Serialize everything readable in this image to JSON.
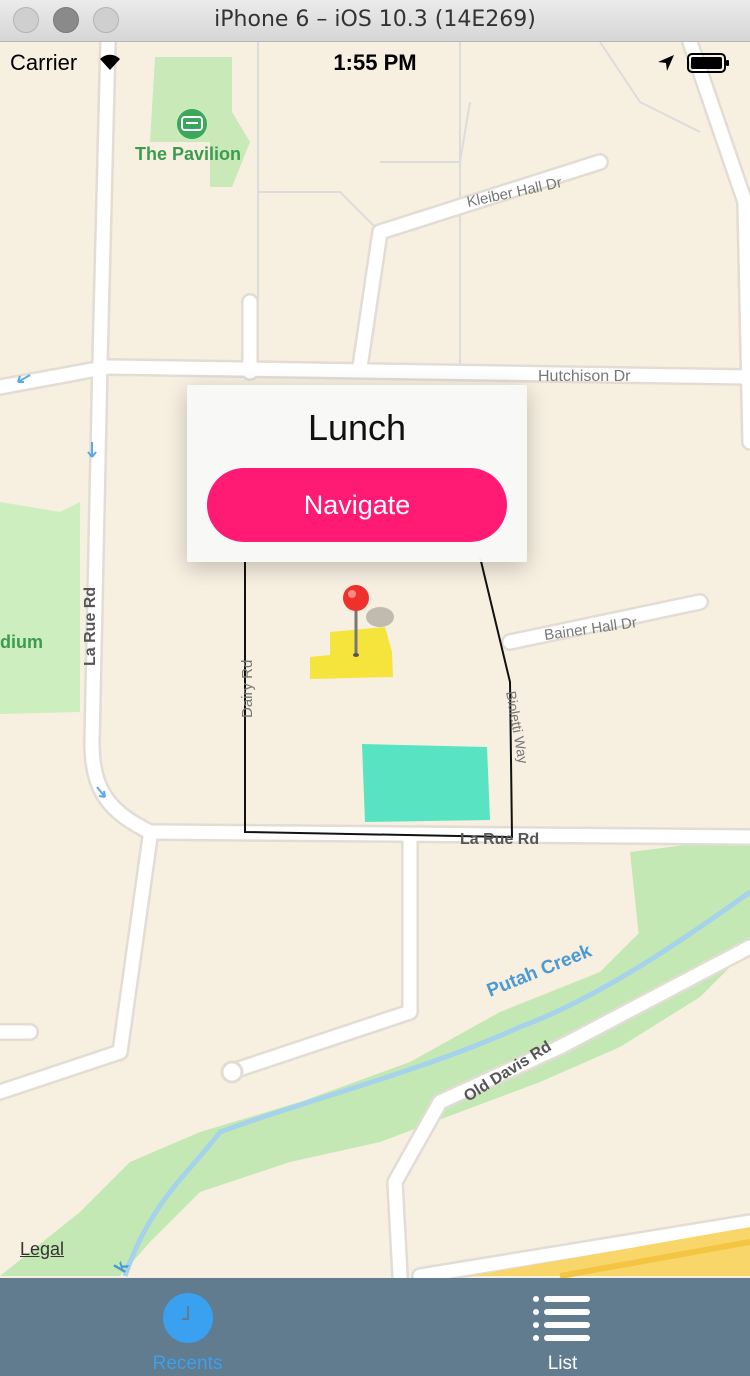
{
  "window": {
    "title": "iPhone 6 – iOS 10.3 (14E269)"
  },
  "status_bar": {
    "carrier": "Carrier",
    "time": "1:55 PM"
  },
  "map": {
    "labels": {
      "pavilion": "The Pavilion",
      "kleiber": "Kleiber Hall Dr",
      "hutchison": "Hutchison Dr",
      "la_rue_vertical": "La Rue Rd",
      "stadium": "dium",
      "dairy": "Dairy Rd",
      "bainer": "Bainer Hall Dr",
      "bioletti": "Bioletti Way",
      "la_rue_horizontal": "La Rue Rd",
      "putah": "Putah Creek",
      "old_davis": "Old Davis Rd",
      "creek_tail": "k"
    },
    "legal": "Legal"
  },
  "callout": {
    "title": "Lunch",
    "button_label": "Navigate"
  },
  "tab_bar": {
    "tabs": [
      {
        "label": "Recents",
        "icon": "clock-icon",
        "selected": true
      },
      {
        "label": "List",
        "icon": "list-icon",
        "selected": false
      }
    ]
  },
  "colors": {
    "accent": "#ff1a74",
    "tab_bar": "#617b8f",
    "tab_selected": "#3aa0f0",
    "map_land": "#f7efe0",
    "map_park": "#c4e8b4",
    "marker_area_yellow": "#f5e43c",
    "marker_area_teal": "#58e3c3"
  }
}
